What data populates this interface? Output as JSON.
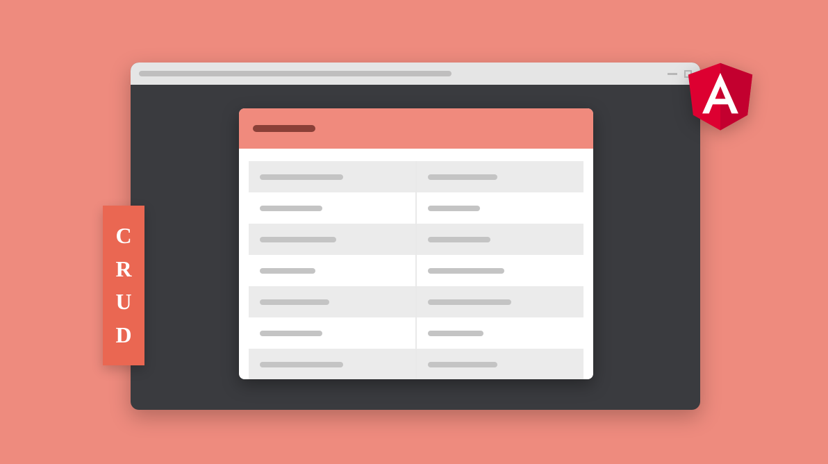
{
  "crud": {
    "c": "C",
    "r": "R",
    "u": "U",
    "d": "D"
  },
  "angular_letter": "A",
  "colors": {
    "bg": "#ee8b7e",
    "dark": "#3a3b3f",
    "accent": "#f08a7d",
    "badge": "#ea6752",
    "angular_red": "#dd0031",
    "angular_dark": "#c3002f"
  }
}
